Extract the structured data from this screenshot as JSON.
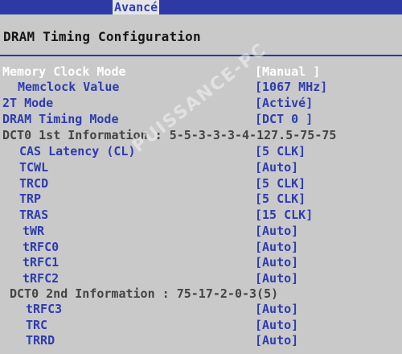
{
  "topbar": {
    "tab_label": "Avancé"
  },
  "page": {
    "title": "DRAM Timing Configuration"
  },
  "settings": [
    {
      "label": "Memory Clock Mode",
      "value": "[Manual ]"
    },
    {
      "label": "Memclock Value",
      "value": "[1067 MHz]"
    },
    {
      "label": "2T Mode",
      "value": "[Activé]"
    },
    {
      "label": "DRAM Timing Mode",
      "value": "[DCT 0 ]"
    },
    {
      "label": "DCT0 1st Information : 5-5-3-3-3-4-127.5-75-75"
    },
    {
      "label": "CAS Latency (CL)",
      "value": "[5 CLK]"
    },
    {
      "label": "TCWL",
      "value": "[Auto]"
    },
    {
      "label": "TRCD",
      "value": "[5 CLK]"
    },
    {
      "label": "TRP",
      "value": "[5 CLK]"
    },
    {
      "label": "TRAS",
      "value": "[15 CLK]"
    },
    {
      "label": "tWR",
      "value": "[Auto]"
    },
    {
      "label": "tRFC0",
      "value": "[Auto]"
    },
    {
      "label": "tRFC1",
      "value": "[Auto]"
    },
    {
      "label": "tRFC2",
      "value": "[Auto]"
    },
    {
      "label": "DCT0 2nd Information : 75-17-2-0-3(5)"
    },
    {
      "label": "tRFC3",
      "value": "[Auto]"
    },
    {
      "label": "TRC",
      "value": "[Auto]"
    },
    {
      "label": "TRRD",
      "value": "[Auto]"
    }
  ],
  "watermark": "PUISSANCE-PC",
  "colors": {
    "topbar": "#2d3aa6",
    "background": "#c9c9c9",
    "selected_label": "#ffffff",
    "option": "#2e3cb0",
    "info_text": "#444444"
  }
}
